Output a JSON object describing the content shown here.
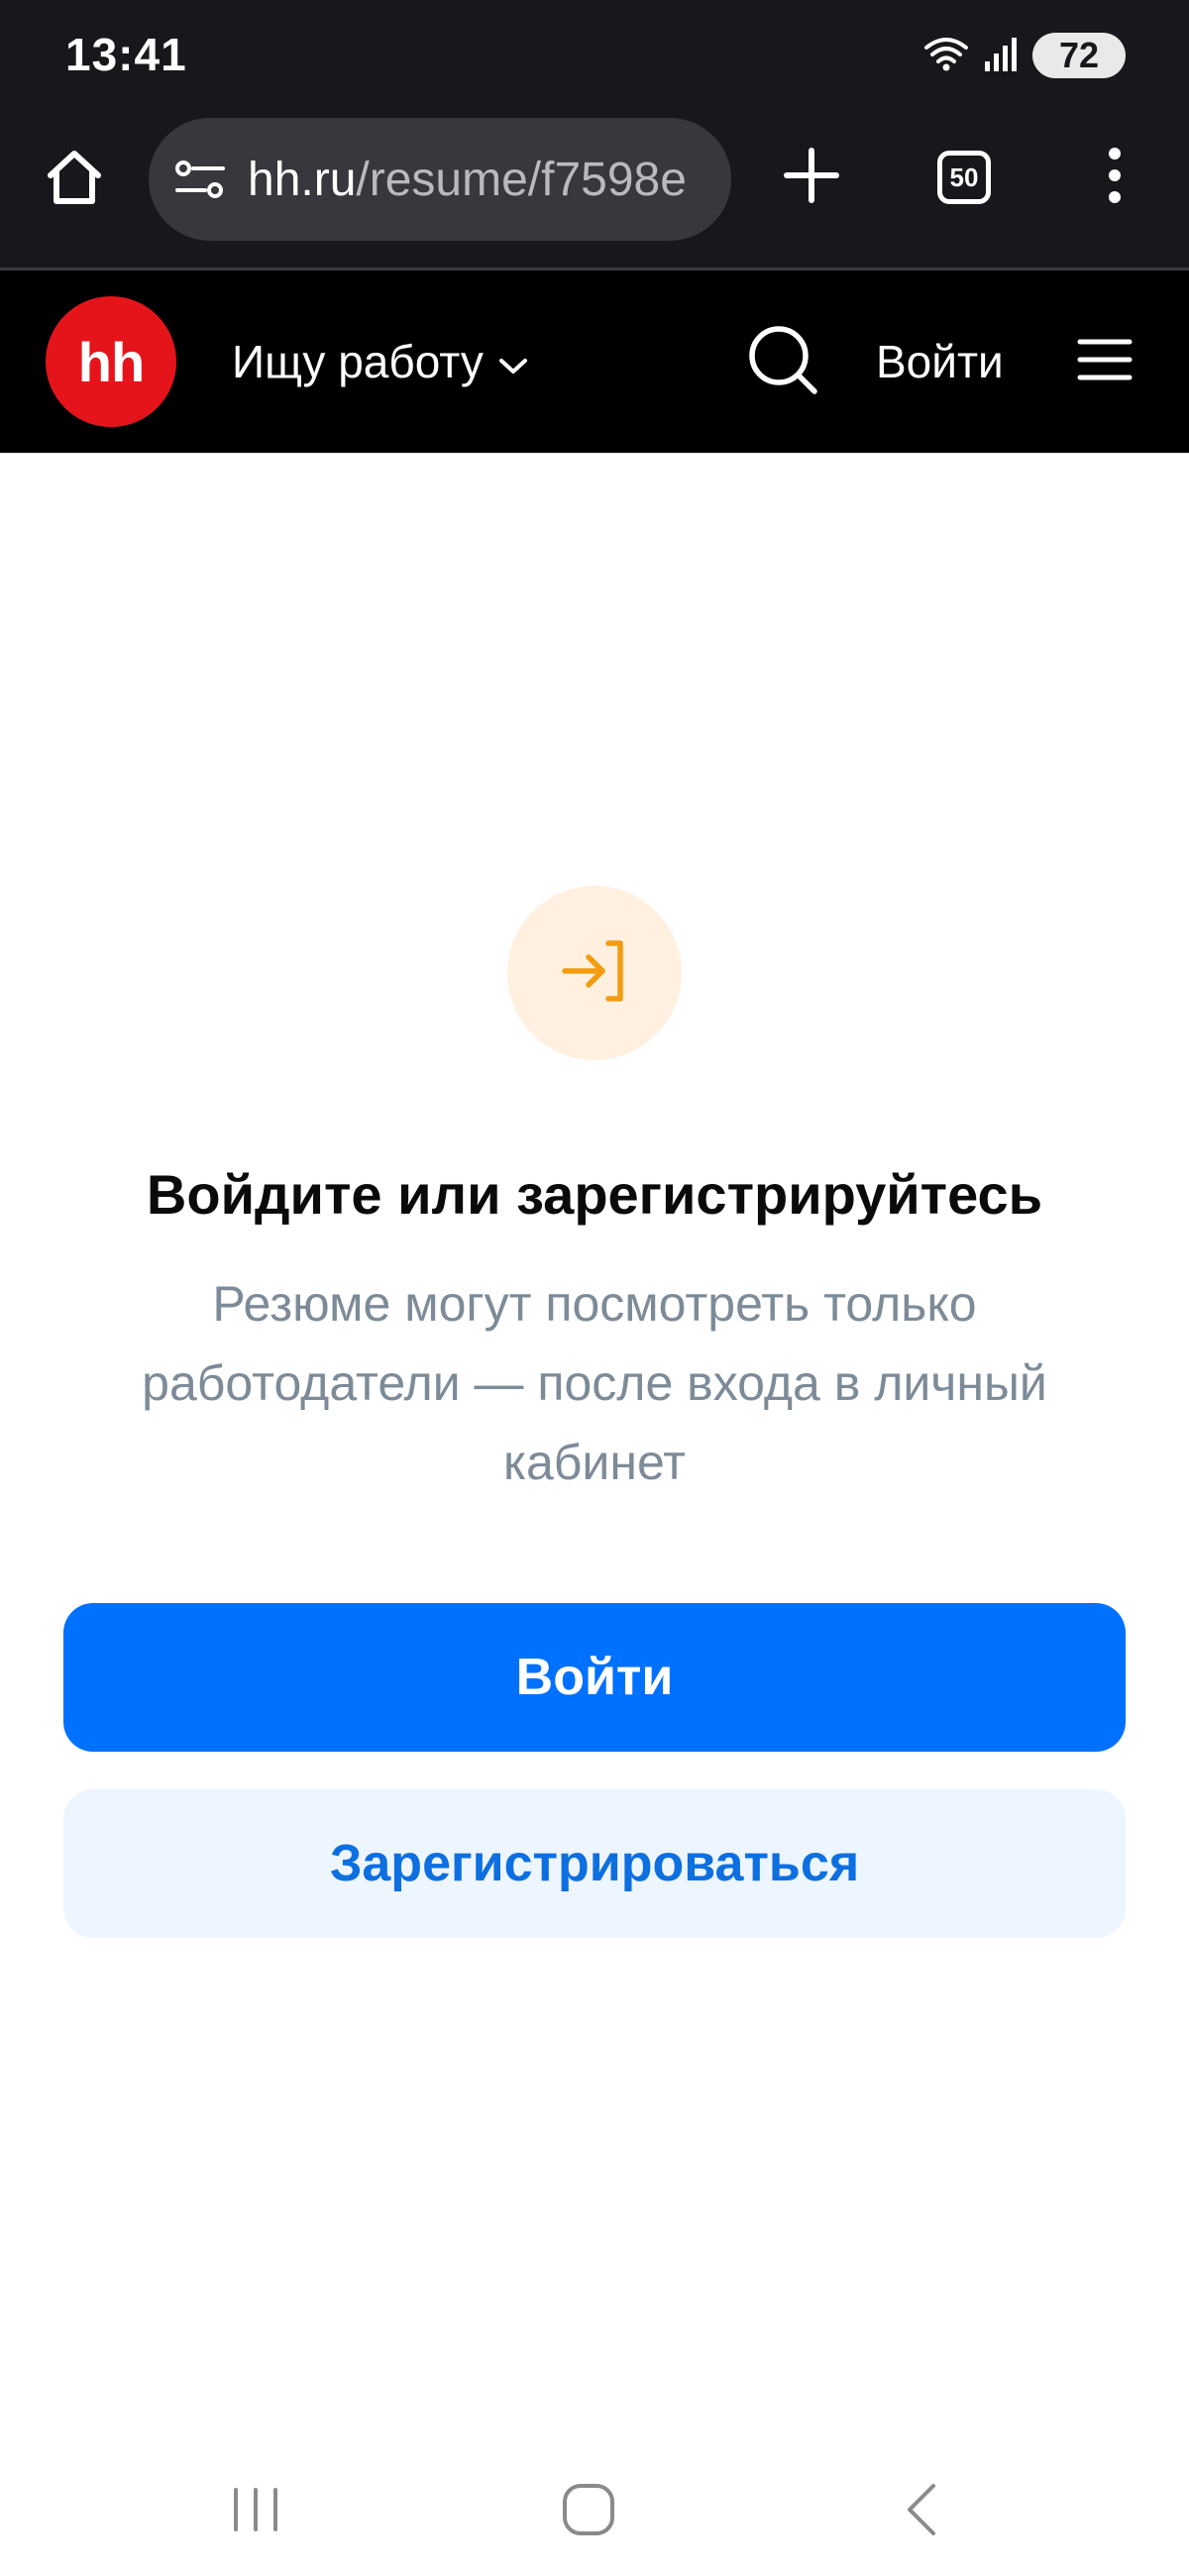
{
  "status_bar": {
    "time": "13:41",
    "battery": "72",
    "icons": [
      "wifi-icon",
      "signal-icon",
      "battery-icon"
    ]
  },
  "browser": {
    "url_host": "hh.ru",
    "url_path": "/resume/f7598e",
    "tab_count": "50",
    "icons": [
      "home-icon",
      "tune-icon",
      "plus-icon",
      "tabs-icon",
      "more-vert-icon"
    ]
  },
  "site_header": {
    "logo_text": "hh",
    "role_selector": "Ищу работу",
    "login_link": "Войти",
    "icons": [
      "chevron-down-icon",
      "search-icon",
      "hamburger-menu-icon"
    ]
  },
  "main": {
    "title": "Войдите или зарегистрируйтесь",
    "subtitle": "Резюме могут посмотреть только работодатели — после входа в личный кабинет",
    "login_button": "Войти",
    "register_button": "Зарегистрироваться",
    "icon": "login-arrow-icon"
  },
  "nav_bar": {
    "icons": [
      "recent-apps-icon",
      "home-nav-icon",
      "back-icon"
    ]
  },
  "colors": {
    "browser_bg": "#18181c",
    "site_header_bg": "#000000",
    "hh_red": "#e5141b",
    "primary_blue": "#0070ff",
    "secondary_bg": "#edf5ff",
    "secondary_text": "#0d6fe0",
    "icon_orange": "#f39c12",
    "icon_circle_bg": "#fff0e0",
    "subtitle_gray": "#7d8b98"
  }
}
